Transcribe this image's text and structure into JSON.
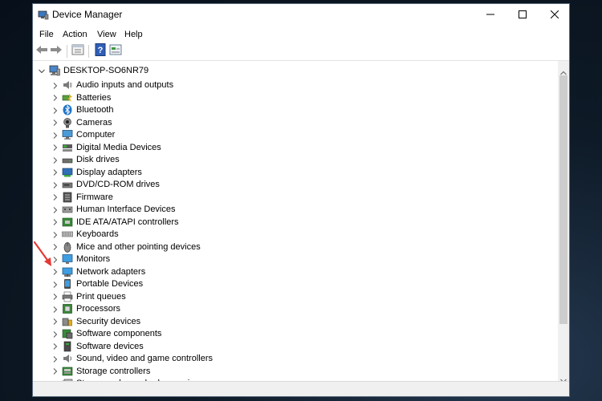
{
  "window": {
    "title": "Device Manager",
    "controls": [
      "minimize-icon",
      "maximize-icon",
      "close-icon"
    ]
  },
  "menu": {
    "items": [
      "File",
      "Action",
      "View",
      "Help"
    ]
  },
  "toolbar": {
    "buttons": [
      "back-arrow-icon",
      "forward-arrow-icon",
      "properties-icon",
      "help-icon",
      "show-hidden-icon"
    ]
  },
  "tree": {
    "root": "DESKTOP-SO6NR79",
    "categories": [
      {
        "label": "Audio inputs and outputs",
        "icon": "speaker-icon"
      },
      {
        "label": "Batteries",
        "icon": "battery-icon"
      },
      {
        "label": "Bluetooth",
        "icon": "bluetooth-icon"
      },
      {
        "label": "Cameras",
        "icon": "camera-icon"
      },
      {
        "label": "Computer",
        "icon": "computer-icon"
      },
      {
        "label": "Digital Media Devices",
        "icon": "media-device-icon"
      },
      {
        "label": "Disk drives",
        "icon": "disk-drive-icon"
      },
      {
        "label": "Display adapters",
        "icon": "display-adapter-icon"
      },
      {
        "label": "DVD/CD-ROM drives",
        "icon": "dvd-drive-icon"
      },
      {
        "label": "Firmware",
        "icon": "firmware-icon"
      },
      {
        "label": "Human Interface Devices",
        "icon": "hid-icon"
      },
      {
        "label": "IDE ATA/ATAPI controllers",
        "icon": "ide-controller-icon"
      },
      {
        "label": "Keyboards",
        "icon": "keyboard-icon"
      },
      {
        "label": "Mice and other pointing devices",
        "icon": "mouse-icon"
      },
      {
        "label": "Monitors",
        "icon": "monitor-icon"
      },
      {
        "label": "Network adapters",
        "icon": "network-adapter-icon"
      },
      {
        "label": "Portable Devices",
        "icon": "portable-device-icon"
      },
      {
        "label": "Print queues",
        "icon": "printer-icon"
      },
      {
        "label": "Processors",
        "icon": "processor-icon"
      },
      {
        "label": "Security devices",
        "icon": "security-device-icon"
      },
      {
        "label": "Software components",
        "icon": "software-component-icon"
      },
      {
        "label": "Software devices",
        "icon": "software-device-icon"
      },
      {
        "label": "Sound, video and game controllers",
        "icon": "sound-icon"
      },
      {
        "label": "Storage controllers",
        "icon": "storage-controller-icon"
      },
      {
        "label": "Storage volume shadow copies",
        "icon": "shadow-copy-icon"
      }
    ]
  },
  "colors": {
    "annotation_arrow": "#e53935",
    "window_border": "#5a6b7d",
    "accent_blue": "#1e73c8"
  }
}
